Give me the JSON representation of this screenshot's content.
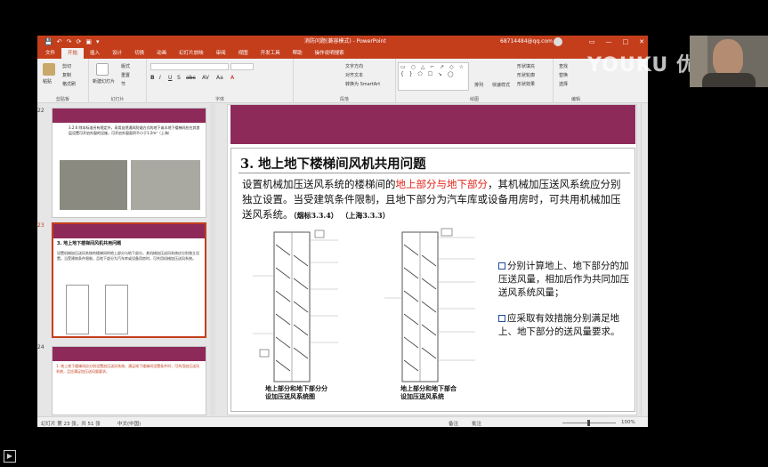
{
  "window": {
    "title": "消防问题(兼容模式) - PowerPoint",
    "account": "68714484@qq.com",
    "controls": [
      "▭",
      "—",
      "□",
      "✕"
    ],
    "qat_icons": [
      "💾",
      "↶",
      "↷",
      "⟳",
      "▣",
      "▾"
    ]
  },
  "tabs": [
    "文件",
    "开始",
    "插入",
    "设计",
    "切换",
    "动画",
    "幻灯片放映",
    "审阅",
    "视图",
    "开发工具",
    "帮助",
    "操作说明搜索"
  ],
  "active_tab": "开始",
  "ribbon": {
    "clipboard": {
      "label": "剪贴板",
      "paste": "粘贴",
      "cut": "剪切",
      "copy": "复制",
      "format_painter": "格式刷"
    },
    "slides": {
      "label": "幻灯片",
      "new_slide": "新建幻灯片",
      "layout": "版式",
      "reset": "重置",
      "section": "节"
    },
    "font": {
      "label": "字体",
      "bold": "B",
      "italic": "I",
      "underline": "U",
      "shadow": "S",
      "strike": "abc",
      "spacing": "AV",
      "case": "Aa",
      "color": "A"
    },
    "paragraph": {
      "label": "段落",
      "text_direction": "文字方向",
      "align_text": "对齐文本",
      "smartart": "转换为 SmartArt"
    },
    "drawing": {
      "label": "绘图",
      "shapes": "▭ ○ △ ⌐ ↗ ◇ ☆ { } ⬠ ☐ ↘ ◯",
      "arrange": "排列",
      "quick_styles": "快速样式",
      "fill": "形状填充",
      "outline": "形状轮廓",
      "effects": "形状效果"
    },
    "editing": {
      "label": "编辑",
      "find": "查找",
      "replace": "替换",
      "select": "选择"
    }
  },
  "thumbnails": [
    {
      "number": "22",
      "text": "3.2.6 除本标准另有规定外，采用自然通风防烟方式的地下或半地下楼梯间应在其首层设置可开启外窗的设施，可开启外窗面积不小于1.2m²（上海）"
    },
    {
      "number": "23",
      "title": "3. 地上地下楼梯间风机共用问题",
      "text": "设置机械加压送风系统的楼梯间的地上部分与地下部分，其机械加压送风系统应分别独立设置。当受建筑条件限制，且地下部分为汽车库或设备用房时，可共用机械加压送风系统。"
    },
    {
      "number": "24",
      "text": "1. 地上地下楼梯间应分别设置加压送风系统，满足地下楼梯间设置条件时，可共用加压送风系统，且应满足加压送风量要求。"
    }
  ],
  "slide": {
    "title": "3. 地上地下楼梯间风机共用问题",
    "para_a": "设置机械加压送风系统的楼梯间的",
    "para_hl": "地上部分与地下部分",
    "para_b": "，其机械加压送风系统应分别独立设置。当受建筑条件限制，且地下部分为汽车库或设备用房时，可共用机械加压送风系统。",
    "ref1": "（烟标3.3.4）",
    "ref2": "（上海3.3.3）",
    "caption_left_1": "地上部分和地下部分分",
    "caption_left_2": "设加压送风系统图",
    "caption_right_1": "地上部分和地下部合",
    "caption_right_2": "设加压送风系统",
    "bullet1": "分别计算地上、地下部分的加压送风量，相加后作为共同加压送风系统风量；",
    "bullet2": "应采取有效措施分别满足地上、地下部分的送风量要求。"
  },
  "status": {
    "slide_info": "幻灯片 第 23 张，共 51 张",
    "language": "中文(中国)",
    "notes": "备注",
    "comments": "批注",
    "zoom": "100%"
  },
  "overlay": {
    "watermark": "YOUKU 优酷"
  },
  "colors": {
    "ribbon": "#c43e1c",
    "slide_band": "#8e2a5a",
    "highlight": "#e2231a",
    "bullet_square": "#1f4e9c"
  }
}
